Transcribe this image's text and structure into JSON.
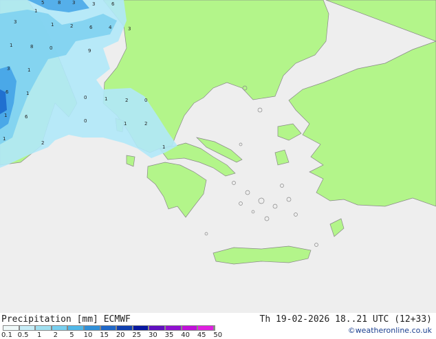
{
  "map": {
    "region": "Greece and Eastern Mediterranean",
    "land_color": "#b3f58a",
    "sea_color": "#eeeeee",
    "precip_colors": [
      "#b0e8f8",
      "#7fd1f0",
      "#4aa8e8",
      "#2070d0"
    ],
    "precip_numbers": [
      "5",
      "3",
      "8",
      "1",
      "3",
      "6",
      "3",
      "1",
      "2",
      "6",
      "4",
      "3",
      "1",
      "8",
      "0",
      "9",
      "3",
      "1",
      "6",
      "1",
      "1",
      "2",
      "0",
      "0",
      "1",
      "6",
      "1",
      "0",
      "2",
      "2",
      "1",
      "1"
    ]
  },
  "legend": {
    "title": "Precipitation [mm]",
    "model": "ECMWF",
    "ticks": [
      "0.1",
      "0.5",
      "1",
      "2",
      "5",
      "10",
      "15",
      "20",
      "25",
      "30",
      "35",
      "40",
      "45",
      "50"
    ],
    "colors": [
      "#f0fafa",
      "#c8eef8",
      "#a0e0f0",
      "#78d0f0",
      "#50b8e8",
      "#3090d8",
      "#2068c8",
      "#1040b0",
      "#0818a0",
      "#6010c0",
      "#9010d0",
      "#c010d8",
      "#e020e0"
    ]
  },
  "run_info": "Th 19-02-2026 18..21 UTC (12+33)",
  "credit": "©weatheronline.co.uk"
}
